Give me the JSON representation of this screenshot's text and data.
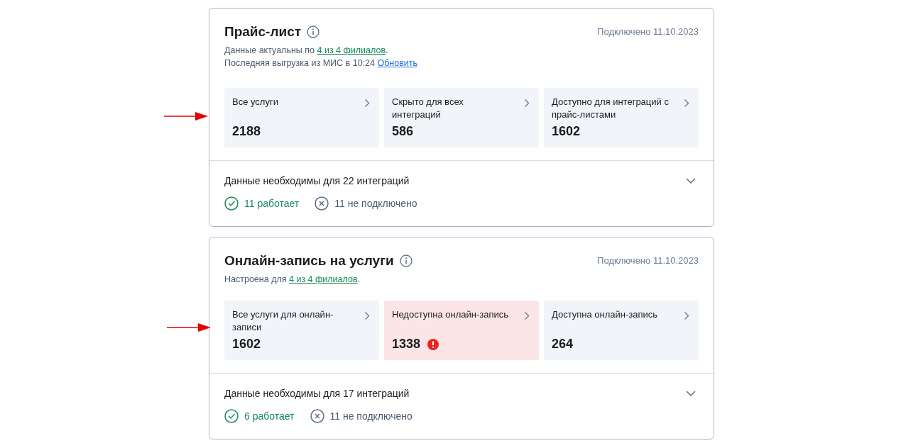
{
  "sections": [
    {
      "title": "Прайс-лист",
      "connected": "Подключено 11.10.2023",
      "lines": [
        {
          "before": "Данные актуальны по ",
          "link": "4 из 4 филиалов",
          "kind": "branches",
          "after": "."
        },
        {
          "before": "Последняя выгрузка из МИС в 10:24 ",
          "link": "Обновить",
          "kind": "action"
        }
      ],
      "tiles": [
        {
          "label": "Все услуги",
          "value": "2188",
          "alert": false
        },
        {
          "label": "Скрыто для всех интеграций",
          "value": "586",
          "alert": false
        },
        {
          "label": "Доступно для интеграций с прайс-листами",
          "value": "1602",
          "alert": false
        }
      ],
      "footer": {
        "title": "Данные необходимы для 22 интеграций",
        "expanded": false,
        "statuses": [
          {
            "kind": "ok",
            "text": "11 работает"
          },
          {
            "kind": "off",
            "text": "11 не подключено"
          }
        ]
      }
    },
    {
      "title": "Онлайн-запись на услуги",
      "connected": "Подключено 11.10.2023",
      "lines": [
        {
          "before": "Настроена для ",
          "link": "4 из 4 филиалов",
          "kind": "branches",
          "after": "."
        }
      ],
      "tiles": [
        {
          "label": "Все услуги для онлайн-записи",
          "value": "1602",
          "alert": false
        },
        {
          "label": "Недоступна онлайн-запись",
          "value": "1338",
          "alert": true
        },
        {
          "label": "Доступна онлайн-запись",
          "value": "264",
          "alert": false
        }
      ],
      "footer": {
        "title": "Данные необходимы для 17 интеграций",
        "expanded": false,
        "statuses": [
          {
            "kind": "ok",
            "text": "6 работает"
          },
          {
            "kind": "off",
            "text": "11 не подключено"
          }
        ]
      }
    }
  ]
}
